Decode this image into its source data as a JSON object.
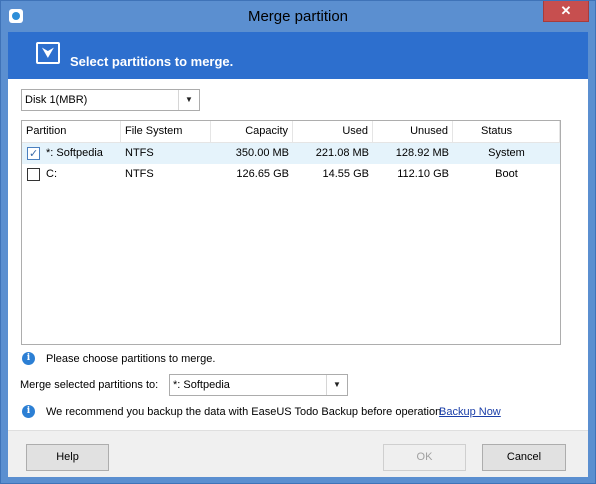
{
  "window": {
    "title": "Merge partition",
    "close_glyph": "✕"
  },
  "banner": {
    "icon": "merge-arrow-icon",
    "heading": "Select partitions to merge."
  },
  "disk_select": {
    "value": "Disk 1(MBR)"
  },
  "table": {
    "columns": [
      "Partition",
      "File System",
      "Capacity",
      "Used",
      "Unused",
      "Status"
    ],
    "rows": [
      {
        "checked": true,
        "partition": "*: Softpedia",
        "fs": "NTFS",
        "capacity": "350.00 MB",
        "used": "221.08 MB",
        "unused": "128.92 MB",
        "status": "System"
      },
      {
        "checked": false,
        "partition": "C:",
        "fs": "NTFS",
        "capacity": "126.65 GB",
        "used": "14.55 GB",
        "unused": "112.10 GB",
        "status": "Boot"
      }
    ]
  },
  "hint": {
    "text": "Please choose partitions to merge."
  },
  "merge_target": {
    "label": "Merge selected partitions to:",
    "value": "*: Softpedia"
  },
  "recommend": {
    "text": "We recommend you backup the data with EaseUS Todo Backup before operation.",
    "link": "Backup Now"
  },
  "buttons": {
    "help": "Help",
    "ok": "OK",
    "cancel": "Cancel"
  }
}
